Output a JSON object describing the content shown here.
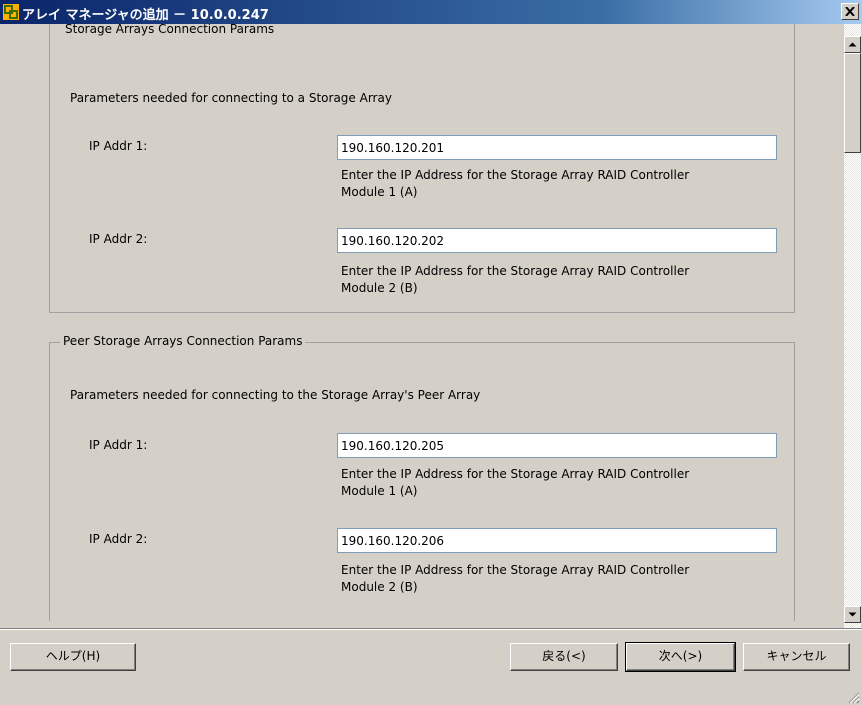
{
  "window": {
    "title": "アレイ マネージャの追加 － 10.0.0.247"
  },
  "storage_group": {
    "legend": "Storage Arrays Connection Params",
    "description": "Parameters needed for connecting to a Storage Array",
    "ip1": {
      "label": "IP Addr 1:",
      "value": "190.160.120.201",
      "help_line1": "Enter the IP Address for the Storage Array RAID Controller",
      "help_line2": "Module 1 (A)"
    },
    "ip2": {
      "label": "IP Addr 2:",
      "value": "190.160.120.202",
      "help_line1": "Enter the IP Address for the Storage Array RAID Controller",
      "help_line2": "Module 2 (B)"
    }
  },
  "peer_group": {
    "legend": "Peer Storage Arrays Connection Params",
    "description": "Parameters needed for connecting to the Storage Array's Peer Array",
    "ip1": {
      "label": "IP Addr 1:",
      "value": "190.160.120.205",
      "help_line1": "Enter the IP Address for the Storage Array RAID Controller",
      "help_line2": "Module 1 (A)"
    },
    "ip2": {
      "label": "IP Addr 2:",
      "value": "190.160.120.206",
      "help_line1": "Enter the IP Address for the Storage Array RAID Controller",
      "help_line2": "Module 2 (B)"
    }
  },
  "footer": {
    "help_label": "ヘルプ(H)",
    "back_label": "戻る(<)",
    "next_label": "次へ(>)",
    "cancel_label": "キャンセル"
  },
  "colors": {
    "titlebar_start": "#0a246a",
    "titlebar_end": "#a6caf0",
    "dialog_bg": "#d4d0c8"
  }
}
